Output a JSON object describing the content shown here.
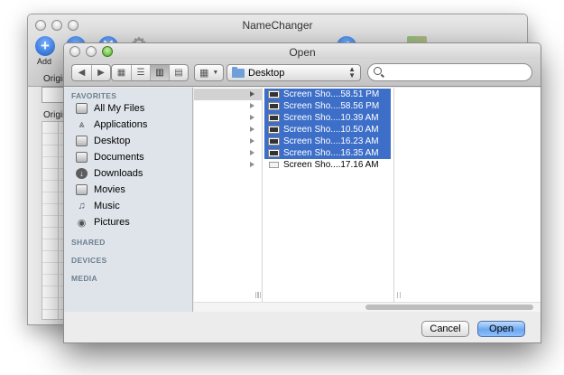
{
  "background_window": {
    "title": "NameChanger",
    "add_label": "Add",
    "original_label": "Origin",
    "original_col_label": "Origin"
  },
  "dialog": {
    "title": "Open",
    "toolbar": {
      "location": "Desktop"
    },
    "sidebar": {
      "favorites_header": "FAVORITES",
      "favorites": [
        {
          "label": "All My Files",
          "icon": "all-files-icon"
        },
        {
          "label": "Applications",
          "icon": "applications-icon"
        },
        {
          "label": "Desktop",
          "icon": "desktop-icon"
        },
        {
          "label": "Documents",
          "icon": "documents-icon"
        },
        {
          "label": "Downloads",
          "icon": "downloads-icon"
        },
        {
          "label": "Movies",
          "icon": "movies-icon"
        },
        {
          "label": "Music",
          "icon": "music-icon"
        },
        {
          "label": "Pictures",
          "icon": "pictures-icon"
        }
      ],
      "shared_header": "SHARED",
      "devices_header": "DEVICES",
      "media_header": "MEDIA"
    },
    "files": [
      {
        "name": "Screen Sho....58.51 PM",
        "selected": true
      },
      {
        "name": "Screen Sho....58.56 PM",
        "selected": true
      },
      {
        "name": "Screen Sho....10.39 AM",
        "selected": true
      },
      {
        "name": "Screen Sho....10.50 AM",
        "selected": true
      },
      {
        "name": "Screen Sho....16.23 AM",
        "selected": true
      },
      {
        "name": "Screen Sho....16.35 AM",
        "selected": true
      },
      {
        "name": "Screen Sho....17.16 AM",
        "selected": false
      }
    ],
    "cancel_label": "Cancel",
    "open_label": "Open"
  },
  "colors": {
    "selection": "#3e6fc8",
    "sidebar_bg": "#dee4ea",
    "default_button": "#6ea7ee"
  }
}
